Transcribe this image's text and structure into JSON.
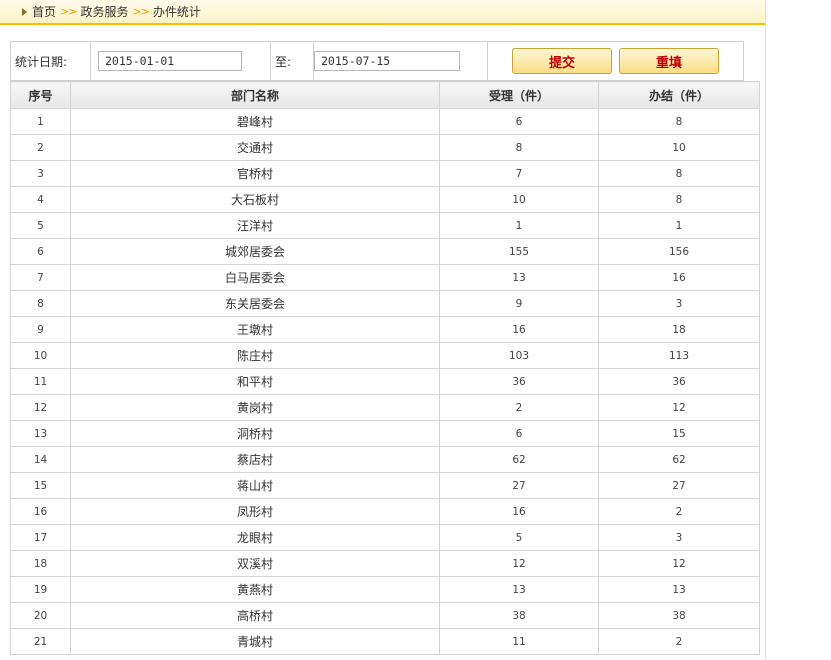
{
  "breadcrumb": {
    "home": "首页",
    "sep1": ">>",
    "section": "政务服务",
    "sep2": ">>",
    "current": "办件统计"
  },
  "filter": {
    "date_label": "统计日期:",
    "start_value": "2015-01-01",
    "to_label": "至:",
    "end_value": "2015-07-15",
    "submit_label": "提交",
    "reset_label": "重填"
  },
  "table": {
    "headers": [
      "序号",
      "部门名称",
      "受理（件）",
      "办结（件）"
    ],
    "rows": [
      [
        "1",
        "碧峰村",
        "6",
        "8"
      ],
      [
        "2",
        "交通村",
        "8",
        "10"
      ],
      [
        "3",
        "官桥村",
        "7",
        "8"
      ],
      [
        "4",
        "大石板村",
        "10",
        "8"
      ],
      [
        "5",
        "汪洋村",
        "1",
        "1"
      ],
      [
        "6",
        "城郊居委会",
        "155",
        "156"
      ],
      [
        "7",
        "白马居委会",
        "13",
        "16"
      ],
      [
        "8",
        "东关居委会",
        "9",
        "3"
      ],
      [
        "9",
        "王墩村",
        "16",
        "18"
      ],
      [
        "10",
        "陈庄村",
        "103",
        "113"
      ],
      [
        "11",
        "和平村",
        "36",
        "36"
      ],
      [
        "12",
        "黄岗村",
        "2",
        "12"
      ],
      [
        "13",
        "洞桥村",
        "6",
        "15"
      ],
      [
        "14",
        "蔡店村",
        "62",
        "62"
      ],
      [
        "15",
        "蒋山村",
        "27",
        "27"
      ],
      [
        "16",
        "凤形村",
        "16",
        "2"
      ],
      [
        "17",
        "龙眼村",
        "5",
        "3"
      ],
      [
        "18",
        "双溪村",
        "12",
        "12"
      ],
      [
        "19",
        "黄燕村",
        "13",
        "13"
      ],
      [
        "20",
        "高桥村",
        "38",
        "38"
      ],
      [
        "21",
        "青城村",
        "11",
        "2"
      ]
    ]
  }
}
